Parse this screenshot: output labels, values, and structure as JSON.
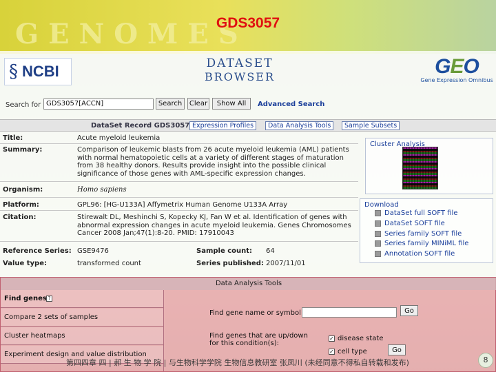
{
  "slide": {
    "title": "GDS3057",
    "banner_word": "GENOMES"
  },
  "logos": {
    "ncbi": "NCBI",
    "dataset_browser_line1": "DATASET",
    "dataset_browser_line2": "BROWSER",
    "geo": "GEO",
    "geo_sub": "Gene Expression Omnibus"
  },
  "search": {
    "label": "Search for",
    "value": "GDS3057[ACCN]",
    "buttons": [
      "Search",
      "Clear",
      "Show All"
    ],
    "advanced": "Advanced Search"
  },
  "record": {
    "title": "DataSet Record GDS3057:",
    "tabs": [
      "Expression Profiles",
      "Data Analysis Tools",
      "Sample Subsets"
    ]
  },
  "fields": {
    "title_label": "Title:",
    "title_value": "Acute myeloid leukemia",
    "summary_label": "Summary:",
    "summary_lines": [
      "Comparison of leukemic blasts from 26 acute myeloid leukemia (AML) patients",
      "with normal hematopoietic cells at a variety of different stages of maturation",
      "from 38 healthy donors. Results provide insight into the possible clinical",
      "significance of those genes with AML-specific expression changes."
    ],
    "organism_label": "Organism:",
    "organism_value": "Homo sapiens",
    "platform_label": "Platform:",
    "platform_value": "GPL96: [HG-U133A] Affymetrix Human Genome U133A Array",
    "citation_label": "Citation:",
    "citation_lines": [
      "Stirewalt DL, Meshinchi S, Kopecky KJ, Fan W et al. Identification of genes with",
      "abnormal expression changes in acute myeloid leukemia. Genes Chromosomes",
      "Cancer 2008 Jan;47(1):8-20. PMID: 17910043"
    ],
    "refseries_label": "Reference Series:",
    "refseries_value": "GSE9476",
    "samplecount_label": "Sample count:",
    "samplecount_value": "64",
    "valuetype_label": "Value type:",
    "valuetype_value": "transformed count",
    "published_label": "Series published:",
    "published_value": "2007/11/01"
  },
  "cluster": {
    "title": "Cluster Analysis"
  },
  "download": {
    "title": "Download",
    "items": [
      "DataSet full SOFT file",
      "DataSet SOFT file",
      "Series family SOFT file",
      "Series family MINiML file",
      "Annotation SOFT file"
    ]
  },
  "tools": {
    "title": "Data Analysis Tools",
    "items": [
      "Find genes",
      "Compare 2 sets of samples",
      "Cluster heatmaps",
      "Experiment design and value distribution"
    ],
    "find_by_name": "Find gene name or symbol:",
    "find_updown_line1": "Find genes that are up/down",
    "find_updown_line2": "for this condition(s):",
    "checkboxes": [
      "disease state",
      "cell type"
    ],
    "go": "Go"
  },
  "footer": {
    "text": "第四四章 四 | 郝 生 物 学 院 | 与生物科学学院 生物信息教研室 张凤川 (未经同意不得私自转载和发布)",
    "page": "8"
  }
}
